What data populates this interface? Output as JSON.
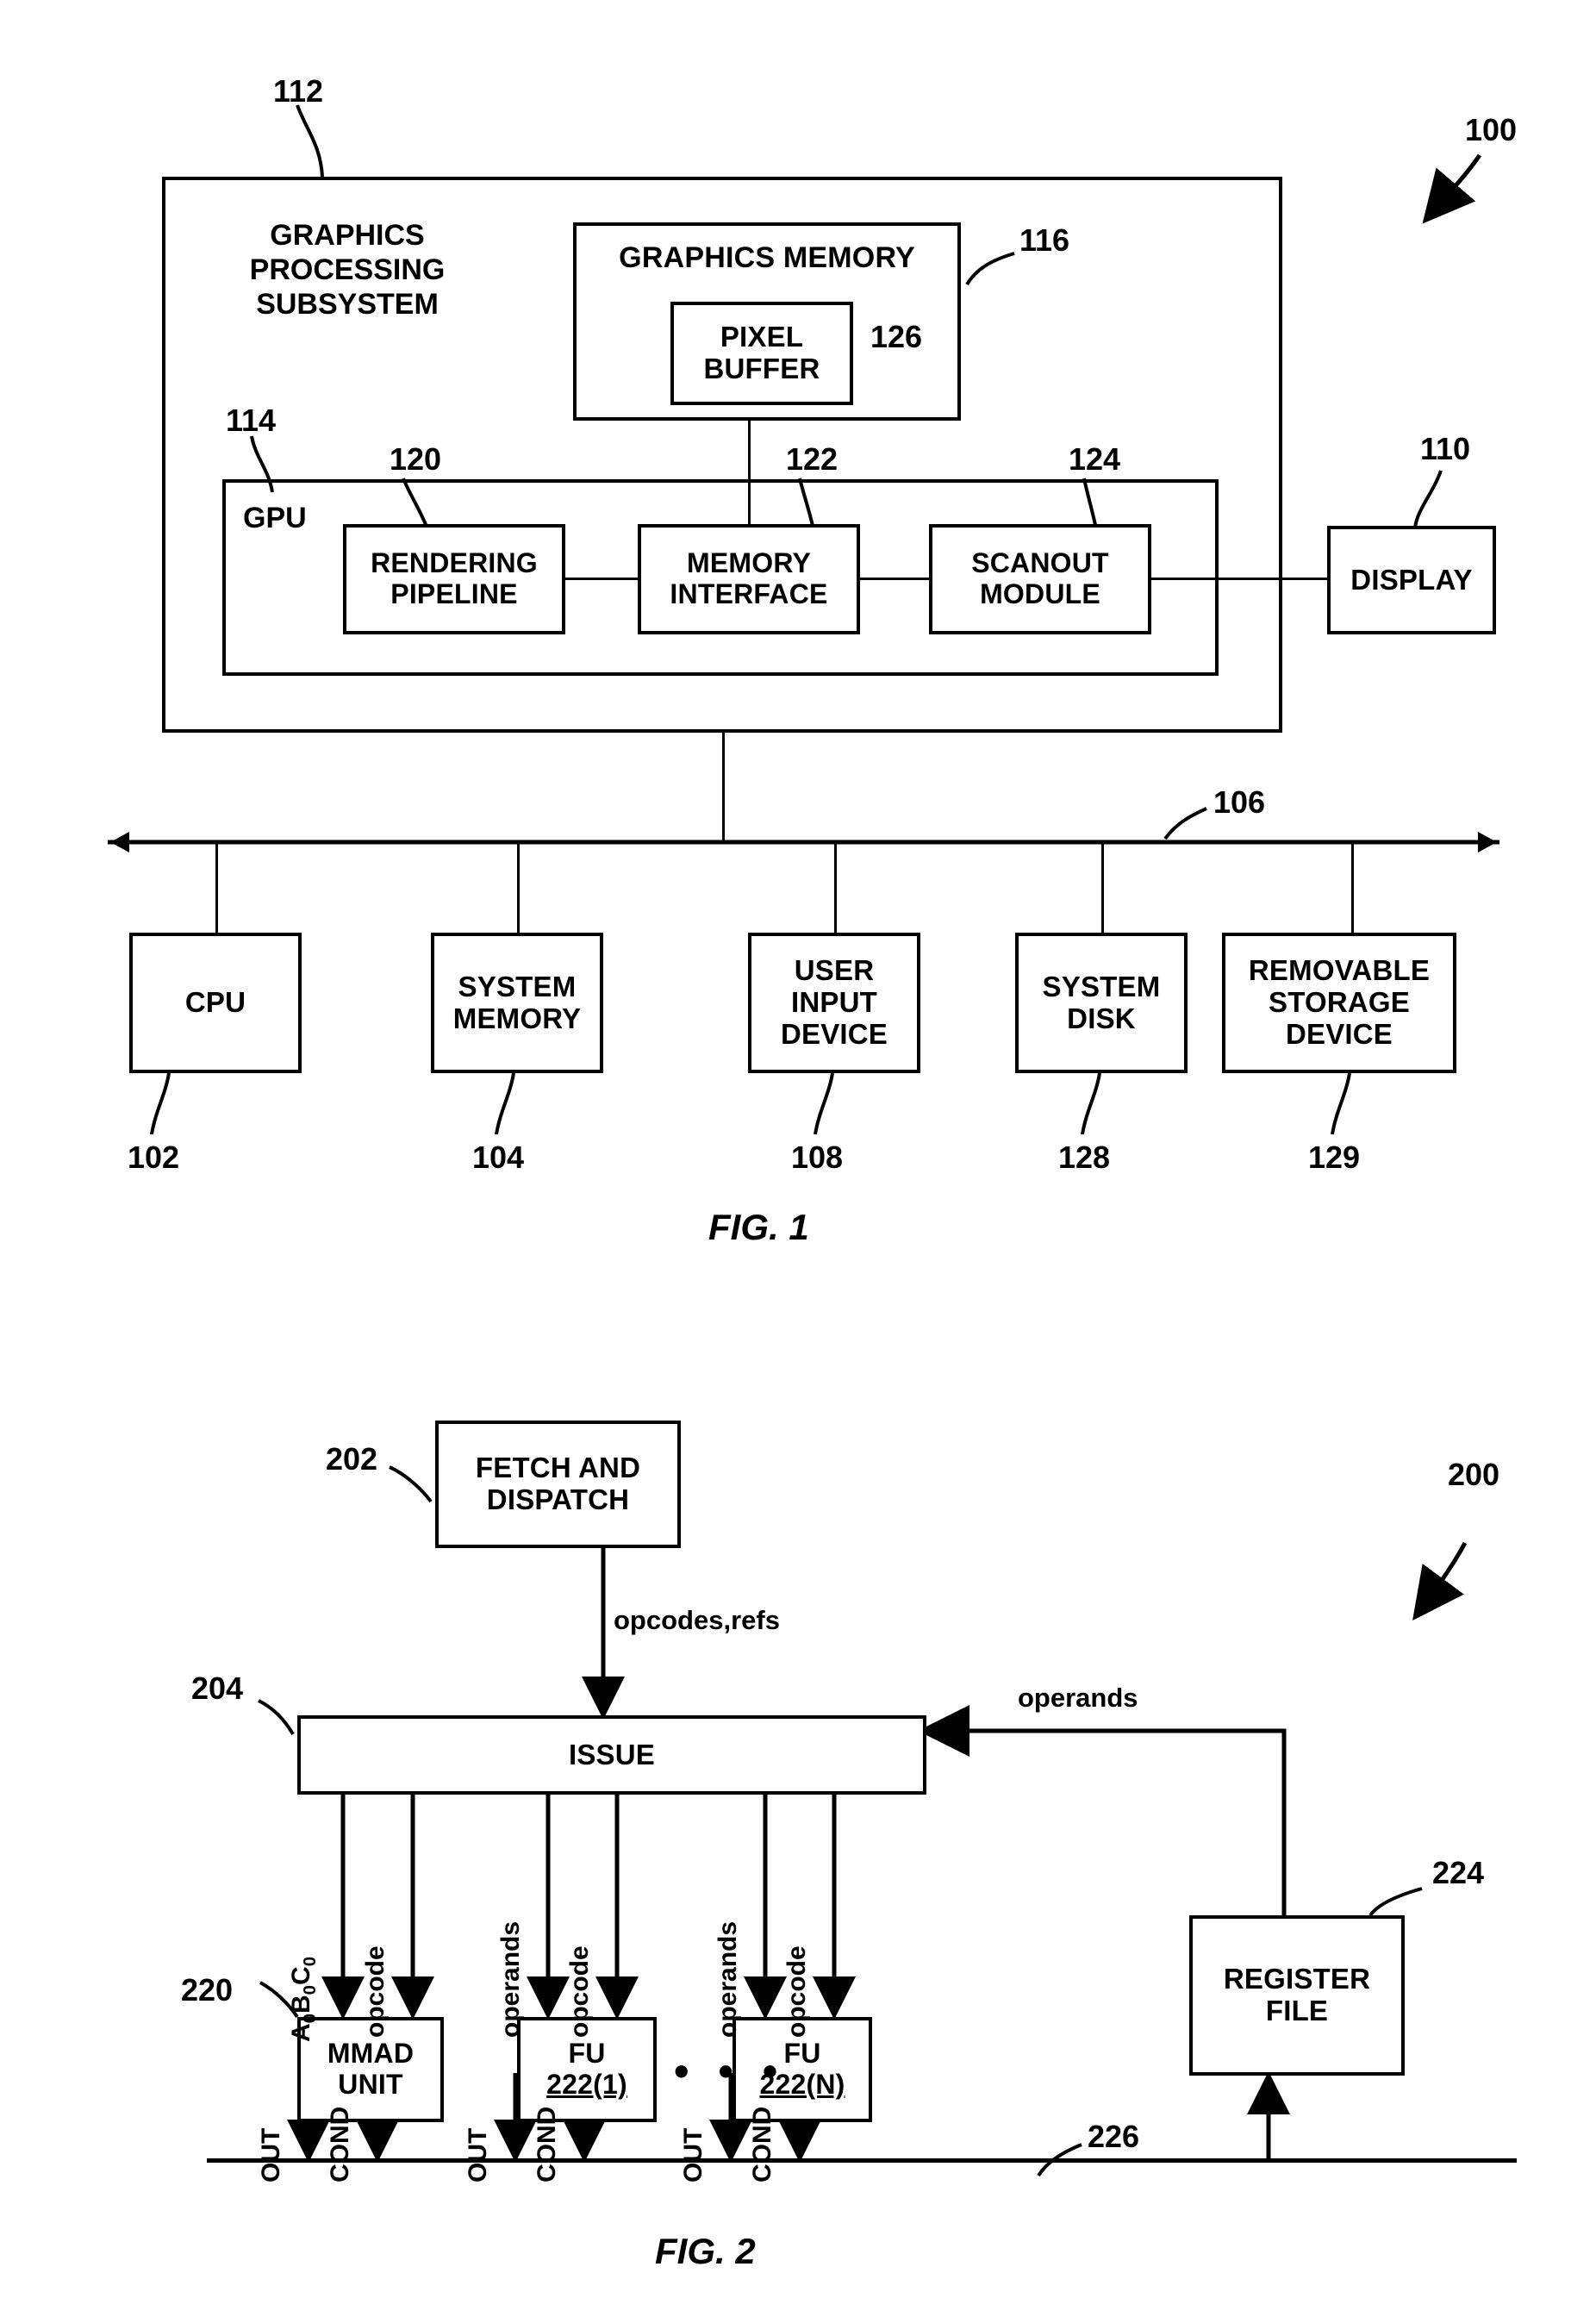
{
  "document": {
    "type": "patent-drawing-sheet",
    "figures": [
      "FIG. 1",
      "FIG. 2"
    ]
  },
  "fig1": {
    "caption": "FIG. 1",
    "system_ref": "100",
    "gps": {
      "label": "GRAPHICS\nPROCESSING\nSUBSYSTEM",
      "label_lines": [
        "GRAPHICS",
        "PROCESSING",
        "SUBSYSTEM"
      ],
      "ref": "112"
    },
    "graphics_memory": {
      "label": "GRAPHICS MEMORY",
      "ref": "116"
    },
    "pixel_buffer": {
      "label_lines": [
        "PIXEL",
        "BUFFER"
      ],
      "ref": "126"
    },
    "gpu": {
      "label": "GPU",
      "ref": "114"
    },
    "rendering_pipeline": {
      "label_lines": [
        "RENDERING",
        "PIPELINE"
      ],
      "ref": "120"
    },
    "memory_interface": {
      "label_lines": [
        "MEMORY",
        "INTERFACE"
      ],
      "ref": "122"
    },
    "scanout_module": {
      "label_lines": [
        "SCANOUT",
        "MODULE"
      ],
      "ref": "124"
    },
    "display": {
      "label": "DISPLAY",
      "ref": "110"
    },
    "bus": {
      "ref": "106"
    },
    "peripherals": [
      {
        "label_lines": [
          "CPU"
        ],
        "ref": "102"
      },
      {
        "label_lines": [
          "SYSTEM",
          "MEMORY"
        ],
        "ref": "104"
      },
      {
        "label_lines": [
          "USER",
          "INPUT",
          "DEVICE"
        ],
        "ref": "108"
      },
      {
        "label_lines": [
          "SYSTEM",
          "DISK"
        ],
        "ref": "128"
      },
      {
        "label_lines": [
          "REMOVABLE",
          "STORAGE",
          "DEVICE"
        ],
        "ref": "129"
      }
    ]
  },
  "fig2": {
    "caption": "FIG. 2",
    "system_ref": "200",
    "fetch_dispatch": {
      "label_lines": [
        "FETCH AND",
        "DISPATCH"
      ],
      "ref": "202"
    },
    "opcodes_refs_label": "opcodes,refs",
    "issue": {
      "label": "ISSUE",
      "ref": "204"
    },
    "operands_feedback_label": "operands",
    "mmad_unit": {
      "label_lines": [
        "MMAD",
        "UNIT"
      ],
      "ref": "220",
      "in_labels": [
        "A0B0C0",
        "opcode"
      ],
      "out_labels": [
        "OUT",
        "COND"
      ]
    },
    "functional_units": [
      {
        "label": "FU",
        "ref": "222(1)",
        "in_labels": [
          "operands",
          "opcode"
        ],
        "out_labels": [
          "OUT",
          "COND"
        ]
      },
      {
        "label": "FU",
        "ref": "222(N)",
        "in_labels": [
          "operands",
          "opcode"
        ],
        "out_labels": [
          "OUT",
          "COND"
        ]
      }
    ],
    "ellipsis": "• • •",
    "register_file": {
      "label_lines": [
        "REGISTER",
        "FILE"
      ],
      "ref": "224"
    },
    "result_bus": {
      "ref": "226"
    }
  }
}
